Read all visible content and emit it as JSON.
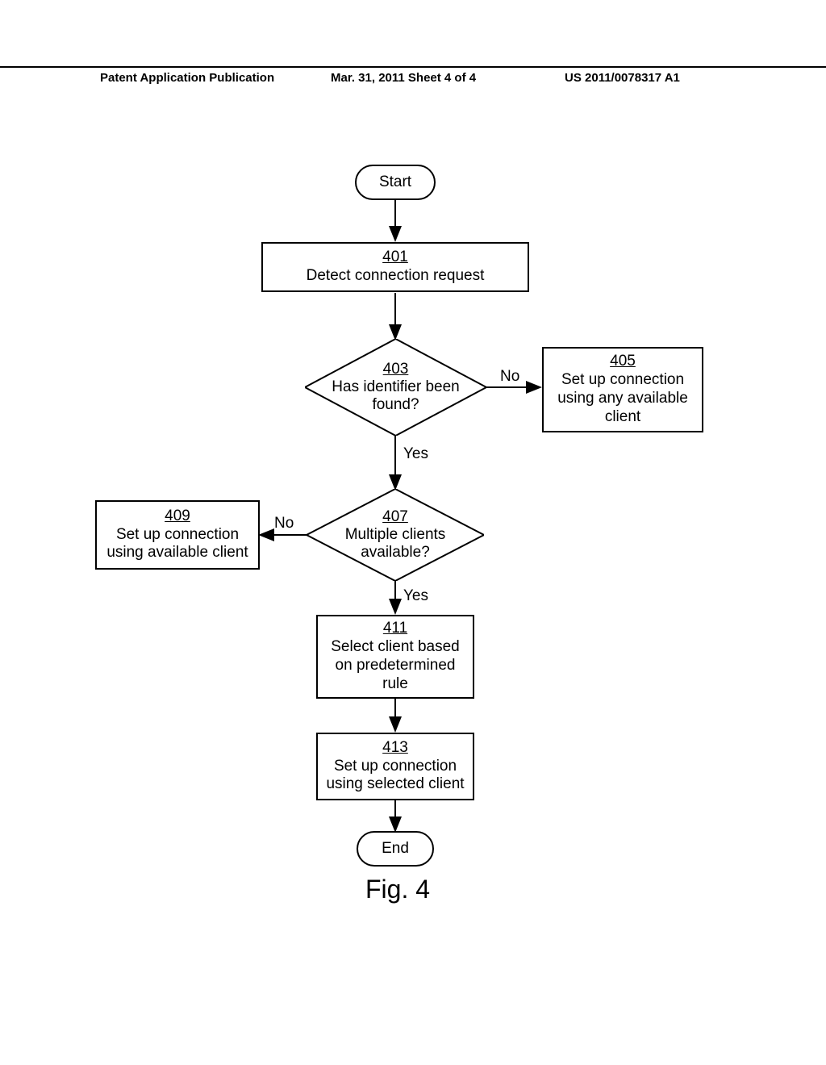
{
  "header": {
    "left": "Patent Application Publication",
    "mid": "Mar. 31, 2011  Sheet 4 of 4",
    "right": "US 2011/0078317 A1"
  },
  "nodes": {
    "start": "Start",
    "n401_ref": "401",
    "n401_text": "Detect connection request",
    "n403_ref": "403",
    "n403_l1": "Has identifier been",
    "n403_l2": "found?",
    "n405_ref": "405",
    "n405_l1": "Set up connection",
    "n405_l2": "using any available",
    "n405_l3": "client",
    "n407_ref": "407",
    "n407_l1": "Multiple clients",
    "n407_l2": "available?",
    "n409_ref": "409",
    "n409_l1": "Set up connection",
    "n409_l2": "using available client",
    "n411_ref": "411",
    "n411_l1": "Select client based",
    "n411_l2": "on predetermined",
    "n411_l3": "rule",
    "n413_ref": "413",
    "n413_l1": "Set up connection",
    "n413_l2": "using selected client",
    "end": "End"
  },
  "labels": {
    "no": "No",
    "yes": "Yes"
  },
  "caption": "Fig. 4",
  "chart_data": {
    "type": "flowchart",
    "title": "Fig. 4",
    "nodes": [
      {
        "id": "start",
        "type": "terminator",
        "label": "Start"
      },
      {
        "id": "401",
        "type": "process",
        "label": "Detect connection request"
      },
      {
        "id": "403",
        "type": "decision",
        "label": "Has identifier been found?"
      },
      {
        "id": "405",
        "type": "process",
        "label": "Set up connection using any available client"
      },
      {
        "id": "407",
        "type": "decision",
        "label": "Multiple clients available?"
      },
      {
        "id": "409",
        "type": "process",
        "label": "Set up connection using available client"
      },
      {
        "id": "411",
        "type": "process",
        "label": "Select client based on predetermined rule"
      },
      {
        "id": "413",
        "type": "process",
        "label": "Set up connection using selected client"
      },
      {
        "id": "end",
        "type": "terminator",
        "label": "End"
      }
    ],
    "edges": [
      {
        "from": "start",
        "to": "401",
        "label": ""
      },
      {
        "from": "401",
        "to": "403",
        "label": ""
      },
      {
        "from": "403",
        "to": "405",
        "label": "No"
      },
      {
        "from": "403",
        "to": "407",
        "label": "Yes"
      },
      {
        "from": "407",
        "to": "409",
        "label": "No"
      },
      {
        "from": "407",
        "to": "411",
        "label": "Yes"
      },
      {
        "from": "411",
        "to": "413",
        "label": ""
      },
      {
        "from": "413",
        "to": "end",
        "label": ""
      }
    ]
  }
}
